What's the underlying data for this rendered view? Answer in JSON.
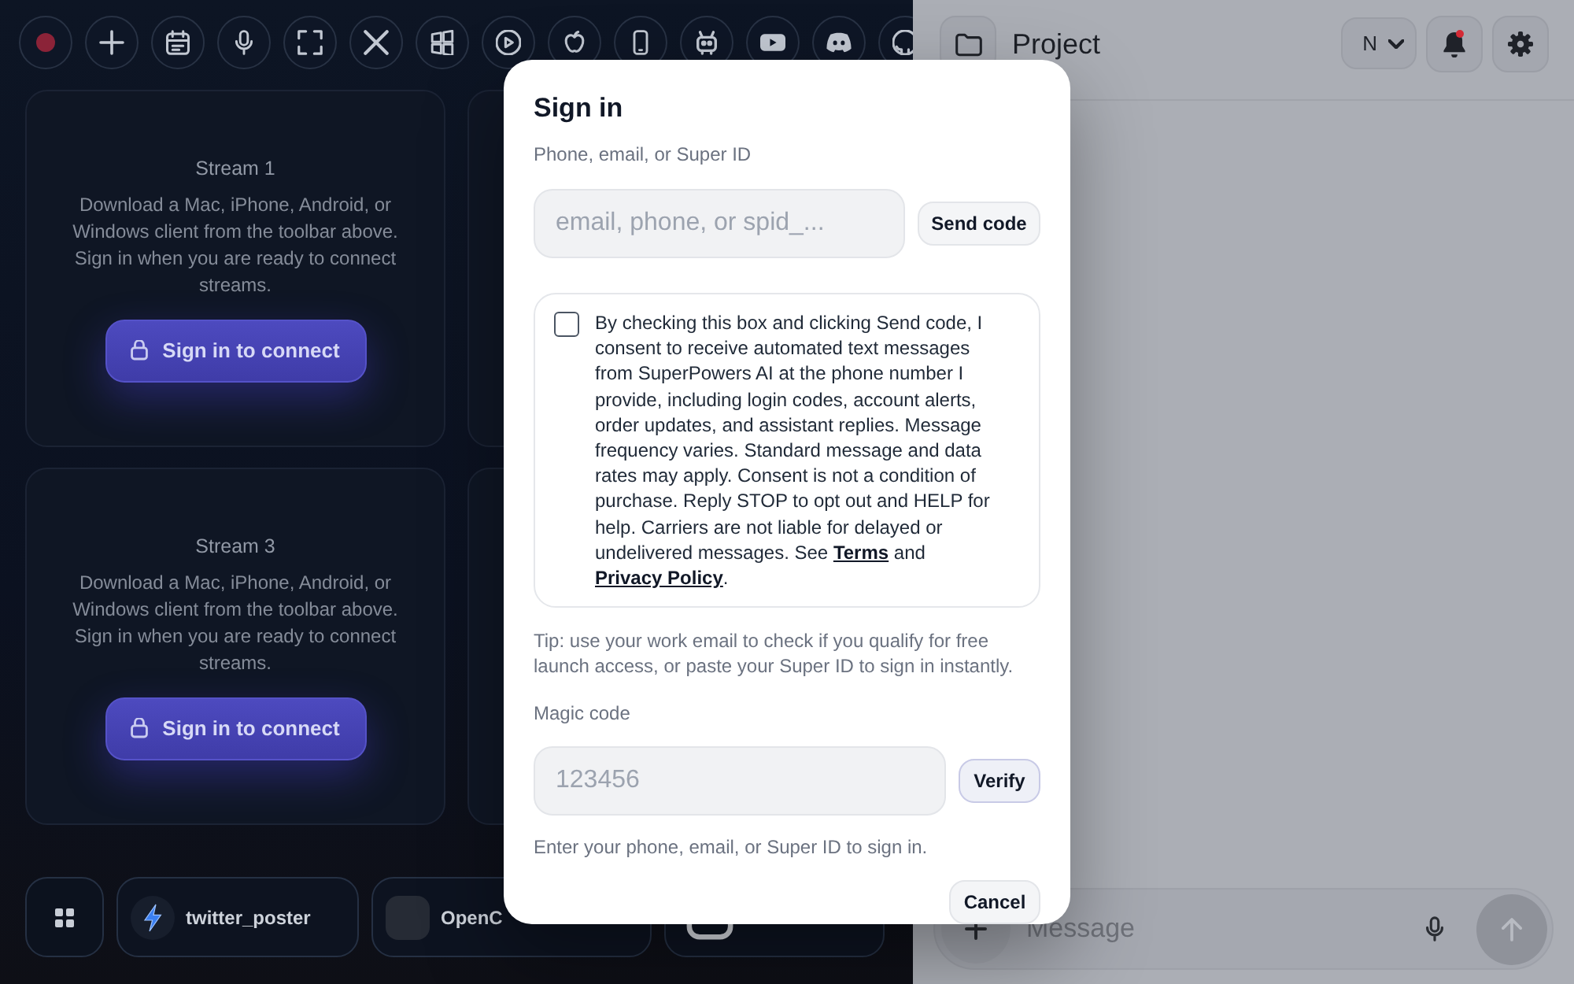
{
  "streams": [
    {
      "title": "Stream 1",
      "description": "Download a Mac, iPhone, Android, or Windows client from the toolbar above. Sign in when you are ready to connect streams.",
      "button": "Sign in to connect"
    },
    {
      "title": "Stream 3",
      "description": "Download a Mac, iPhone, Android, or Windows client from the toolbar above. Sign in when you are ready to connect streams.",
      "button": "Sign in to connect"
    }
  ],
  "dock": {
    "apps": [
      {
        "label": "twitter_poster"
      },
      {
        "label": "OpenC"
      }
    ]
  },
  "project_panel": {
    "title": "Project",
    "select_value": "N",
    "has_unread": true,
    "composer": {
      "placeholder": "Message"
    }
  },
  "sign_in": {
    "title": "Sign in",
    "id_label": "Phone, email, or Super ID",
    "id_field": {
      "placeholder": "email, phone, or spid_..."
    },
    "send_button": "Send code",
    "consent": {
      "checked": false,
      "parts": [
        {
          "kind": "text",
          "text": "By checking this box and clicking Send code, I consent to receive automated text messages from SuperPowers AI at the phone number I provide, including login codes, account alerts, order updates, and assistant replies. Message frequency varies. Standard message and data rates may apply. Consent is not a condition of purchase. Reply STOP to opt out and HELP for help. Carriers are not liable for delayed or undelivered messages. See "
        },
        {
          "kind": "link",
          "text": "Terms"
        },
        {
          "kind": "text",
          "text": " and "
        },
        {
          "kind": "link",
          "text": "Privacy Policy"
        },
        {
          "kind": "text",
          "text": "."
        }
      ]
    },
    "tip": "Tip: use your work email to check if you qualify for free launch access, or paste your Super ID to sign in instantly.",
    "code_label": "Magic code",
    "code_field": {
      "placeholder": "123456"
    },
    "verify_button": "Verify",
    "helper": "Enter your phone, email, or Super ID to sign in.",
    "cancel_button": "Cancel"
  }
}
